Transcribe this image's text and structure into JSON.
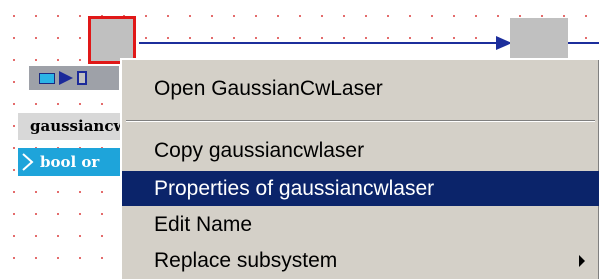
{
  "canvas": {
    "block_name_label": "gaussiancwlaser",
    "port_type_label": "bool or"
  },
  "icons": {
    "toolbar": [
      "port-square-icon",
      "arrow-right-icon",
      "block-small-icon"
    ]
  },
  "context_menu": {
    "items": [
      {
        "label": "Open GaussianCwLaser",
        "highlighted": false
      },
      {
        "label": "Copy gaussiancwlaser",
        "highlighted": false
      },
      {
        "label": "Properties of gaussiancwlaser",
        "highlighted": true
      },
      {
        "label": "Edit Name",
        "highlighted": false
      },
      {
        "label": "Replace subsystem",
        "highlighted": false,
        "has_submenu": true
      }
    ]
  },
  "colors": {
    "menu_bg": "#d4d0c8",
    "highlight": "#0b246a",
    "wire": "#1c2e9c",
    "selection_border": "#e01818",
    "port_tag": "#1ea4da"
  }
}
